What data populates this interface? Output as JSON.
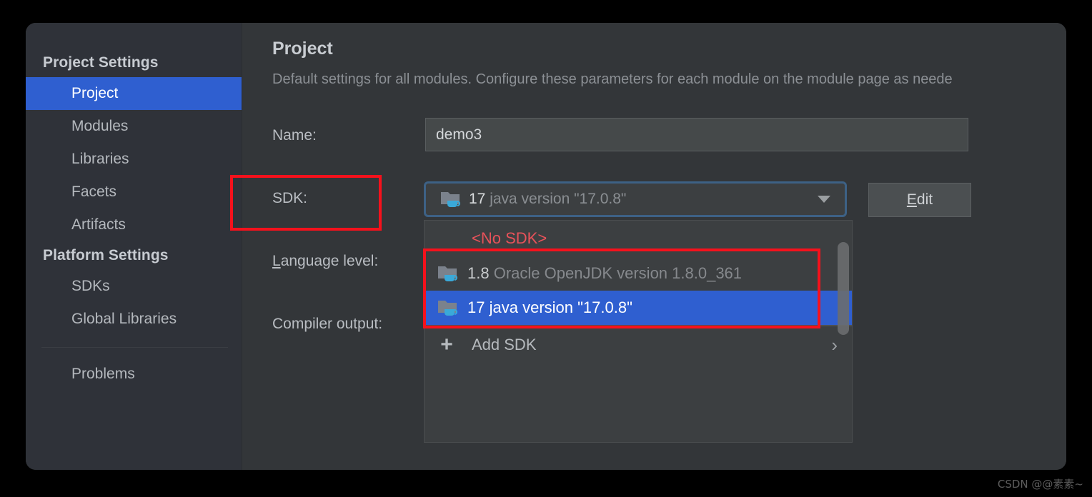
{
  "sidebar": {
    "groups": [
      {
        "title": "Project Settings",
        "items": [
          {
            "label": "Project",
            "selected": true
          },
          {
            "label": "Modules",
            "selected": false
          },
          {
            "label": "Libraries",
            "selected": false
          },
          {
            "label": "Facets",
            "selected": false
          },
          {
            "label": "Artifacts",
            "selected": false
          }
        ]
      },
      {
        "title": "Platform Settings",
        "items": [
          {
            "label": "SDKs",
            "selected": false
          },
          {
            "label": "Global Libraries",
            "selected": false
          }
        ]
      }
    ],
    "footer_items": [
      {
        "label": "Problems",
        "selected": false
      }
    ]
  },
  "main": {
    "title": "Project",
    "subtitle": "Default settings for all modules. Configure these parameters for each module on the module page as neede",
    "labels": {
      "name": "Name:",
      "sdk": "SDK:",
      "language_level_prefix": "L",
      "language_level_rest": "anguage level:",
      "compiler_output": "Compiler output:"
    },
    "name_field": {
      "value": "demo3",
      "placeholder": ""
    },
    "sdk_combo": {
      "icon": "java-sdk-folder-icon",
      "version": "17",
      "description": "java version \"17.0.8\"",
      "arrow_icon": "chevron-down-icon"
    },
    "edit_button": {
      "mnemonic": "E",
      "rest": "dit"
    }
  },
  "dropdown": {
    "no_sdk_label": "<No SDK>",
    "options": [
      {
        "icon": "java-sdk-folder-icon",
        "version": "1.8",
        "description": "Oracle OpenJDK version 1.8.0_361",
        "selected": false
      },
      {
        "icon": "java-sdk-folder-icon",
        "version": "17",
        "description": "java version \"17.0.8\"",
        "selected": true
      }
    ],
    "add_sdk": {
      "plus_icon": "plus-icon",
      "label": "Add SDK",
      "chevron": "chevron-right-icon",
      "chevron_glyph": "›"
    }
  },
  "annotations": {
    "sdk_label_box": "red-highlight-rectangle",
    "options_box": "red-highlight-rectangle",
    "color": "#f5111c"
  },
  "watermark": "CSDN @@素素~",
  "colors": {
    "accent_selection": "#2f5fd0",
    "dialog_bg": "#3c3f41",
    "sidebar_bg": "#2f3239",
    "content_bg": "#333639",
    "error_text": "#e8525a",
    "annotation_red": "#f5111c"
  }
}
